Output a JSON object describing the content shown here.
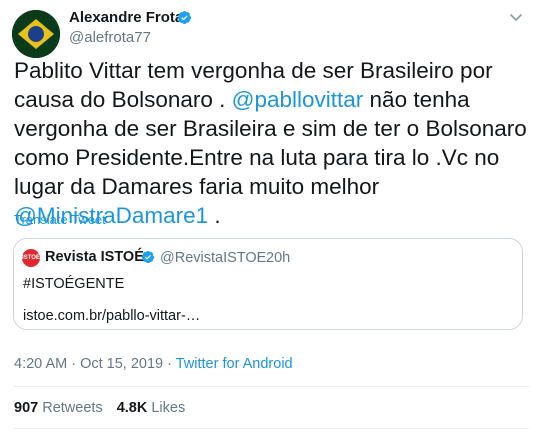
{
  "author": {
    "name": "Alexandre Frota",
    "handle": "@alefrota77"
  },
  "tweet": {
    "text_parts": [
      {
        "type": "text",
        "value": "Pablito Vittar tem vergonha de ser Brasileiro por causa do Bolsonaro . "
      },
      {
        "type": "mention",
        "value": "@pabllovittar"
      },
      {
        "type": "text",
        "value": " não tenha vergonha de ser Brasileira e sim de ter o Bolsonaro como Presidente.Entre na luta para tira lo .Vc no lugar da Damares faria muito melhor "
      },
      {
        "type": "mention",
        "value": "@MinistraDamare1"
      },
      {
        "type": "text",
        "value": " ."
      }
    ],
    "translate_label": "Translate Tweet"
  },
  "quote": {
    "logo_text": "ISTOÉ",
    "name": "Revista ISTOÉ",
    "handle": "@RevistaISTOE",
    "separator": "·",
    "time": "20h",
    "text": "#ISTOÉGENTE",
    "link": "istoe.com.br/pabllo-vittar-…"
  },
  "meta": {
    "time": "4:20 AM",
    "separator": " · ",
    "date": "Oct 15, 2019",
    "source": "Twitter for Android"
  },
  "stats": {
    "retweets_count": "907",
    "retweets_label": "Retweets",
    "likes_count": "4.8K",
    "likes_label": "Likes"
  },
  "colors": {
    "accent": "#1b95e0",
    "secondary_text": "#657786",
    "border": "#ccd6dd",
    "istoe_red": "#e0282e"
  }
}
